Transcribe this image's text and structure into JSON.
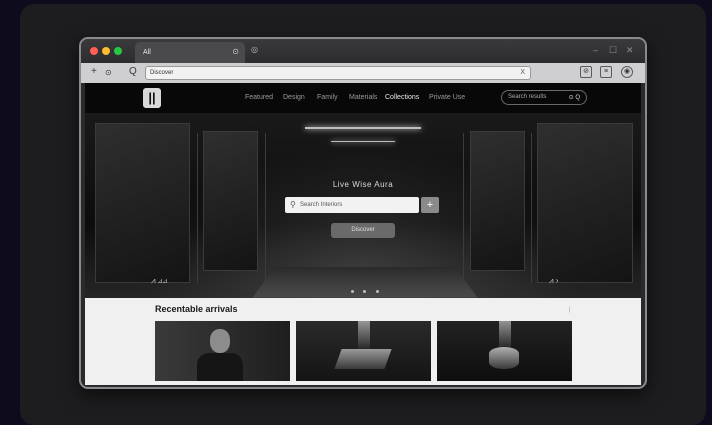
{
  "browser": {
    "tab_title": "All",
    "tab_close": "⊙",
    "new_tab": "◎",
    "address": "Discover",
    "url_clear": "X",
    "win_min": "–",
    "win_max": "☐",
    "win_close": "✕",
    "back": "+",
    "refresh": "⊙",
    "search": "Q",
    "ext1": "⊘",
    "ext2": "≡",
    "ext3": "◉"
  },
  "site": {
    "logo": "||",
    "nav": [
      "Featured",
      "Design",
      "Family",
      "Materials",
      "Collections",
      "Private Use"
    ],
    "nav_active_index": 4,
    "search_placeholder": "Search results",
    "search_go": "⊙ Q"
  },
  "hero": {
    "title": "Live Wise Aura",
    "search_placeholder": "Search Interiors",
    "plus": "+",
    "cta": "Discover",
    "left_ctl": "⩘  ⊿⊿",
    "right_ctl": "⩘  ›",
    "slide_count": 3
  },
  "section": {
    "title": "Recentable arrivals",
    "scroll_mark": "|"
  }
}
